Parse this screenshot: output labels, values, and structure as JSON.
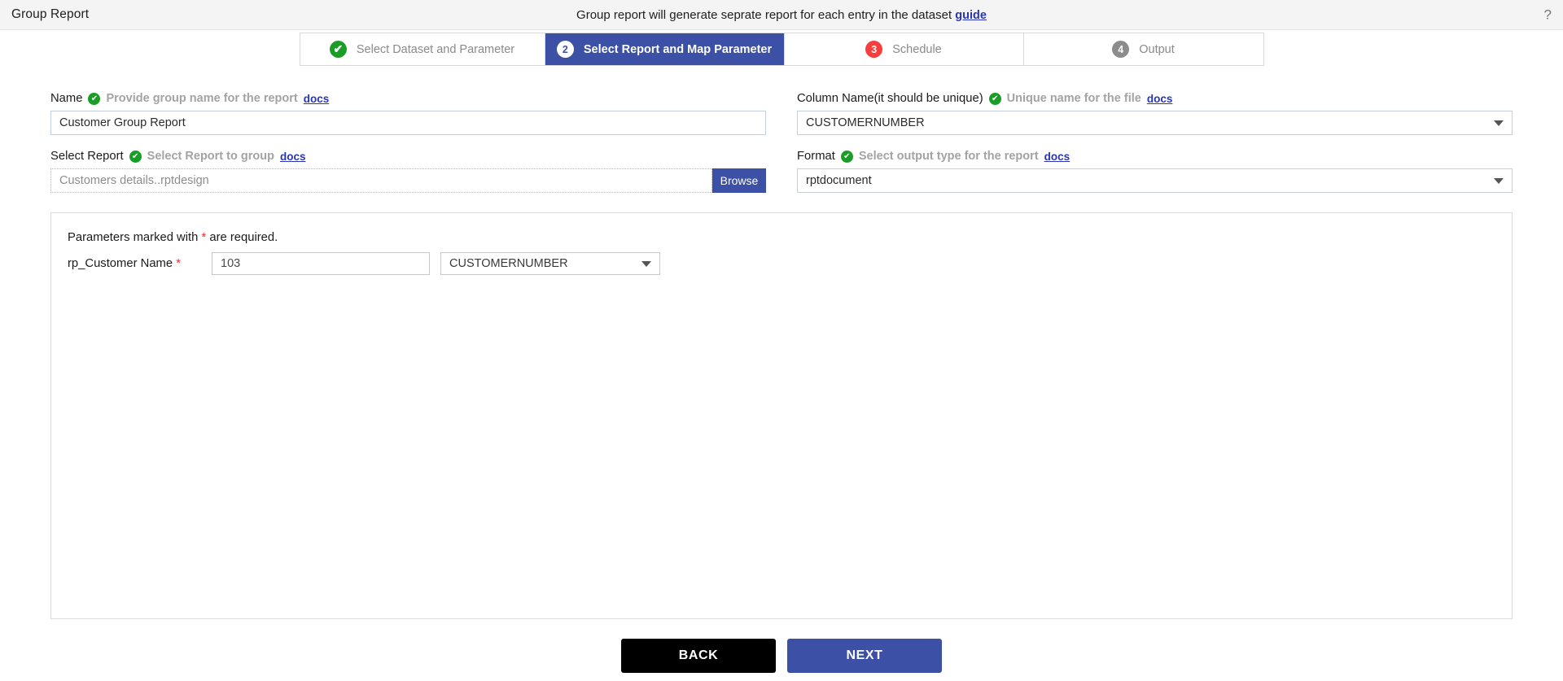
{
  "topbar": {
    "title": "Group Report",
    "message": "Group report will generate seprate report for each entry in the dataset",
    "guide_link": "guide",
    "help_icon": "question-mark-icon"
  },
  "stepper": {
    "steps": [
      {
        "num": "1",
        "label": "Select Dataset and Parameter",
        "state": "done",
        "glyph": "✔"
      },
      {
        "num": "2",
        "label": "Select Report and Map Parameter",
        "state": "current",
        "glyph": "2"
      },
      {
        "num": "3",
        "label": "Schedule",
        "state": "error",
        "glyph": "3"
      },
      {
        "num": "4",
        "label": "Output",
        "state": "pending",
        "glyph": "4"
      }
    ]
  },
  "form": {
    "name": {
      "label": "Name",
      "hint": "Provide group name for the report",
      "docs": "docs",
      "value": "Customer Group Report",
      "placeholder": "Provide group name for the report"
    },
    "column_name": {
      "label": "Column Name(it should be unique)",
      "hint": "Unique name for the file",
      "docs": "docs",
      "value": "CUSTOMERNUMBER"
    },
    "select_report": {
      "label": "Select Report",
      "hint": "Select Report to group",
      "docs": "docs",
      "value": "Customers details..rptdesign",
      "browse_label": "Browse"
    },
    "format": {
      "label": "Format",
      "hint": "Select output type for the report",
      "docs": "docs",
      "value": "rptdocument"
    }
  },
  "parameters": {
    "note_prefix": "Parameters marked with ",
    "note_star": "*",
    "note_suffix": " are required.",
    "rows": [
      {
        "name": "rp_Customer Name",
        "required_star": "*",
        "value": "103",
        "mapped_column": "CUSTOMERNUMBER"
      }
    ]
  },
  "footer": {
    "back_label": "BACK",
    "next_label": "NEXT"
  },
  "colors": {
    "primary": "#3c51a6",
    "success": "#1a9d27",
    "error": "#fa3c3c",
    "pending": "#8c8c8c",
    "link": "#2a35b5",
    "back_button": "#000000"
  }
}
